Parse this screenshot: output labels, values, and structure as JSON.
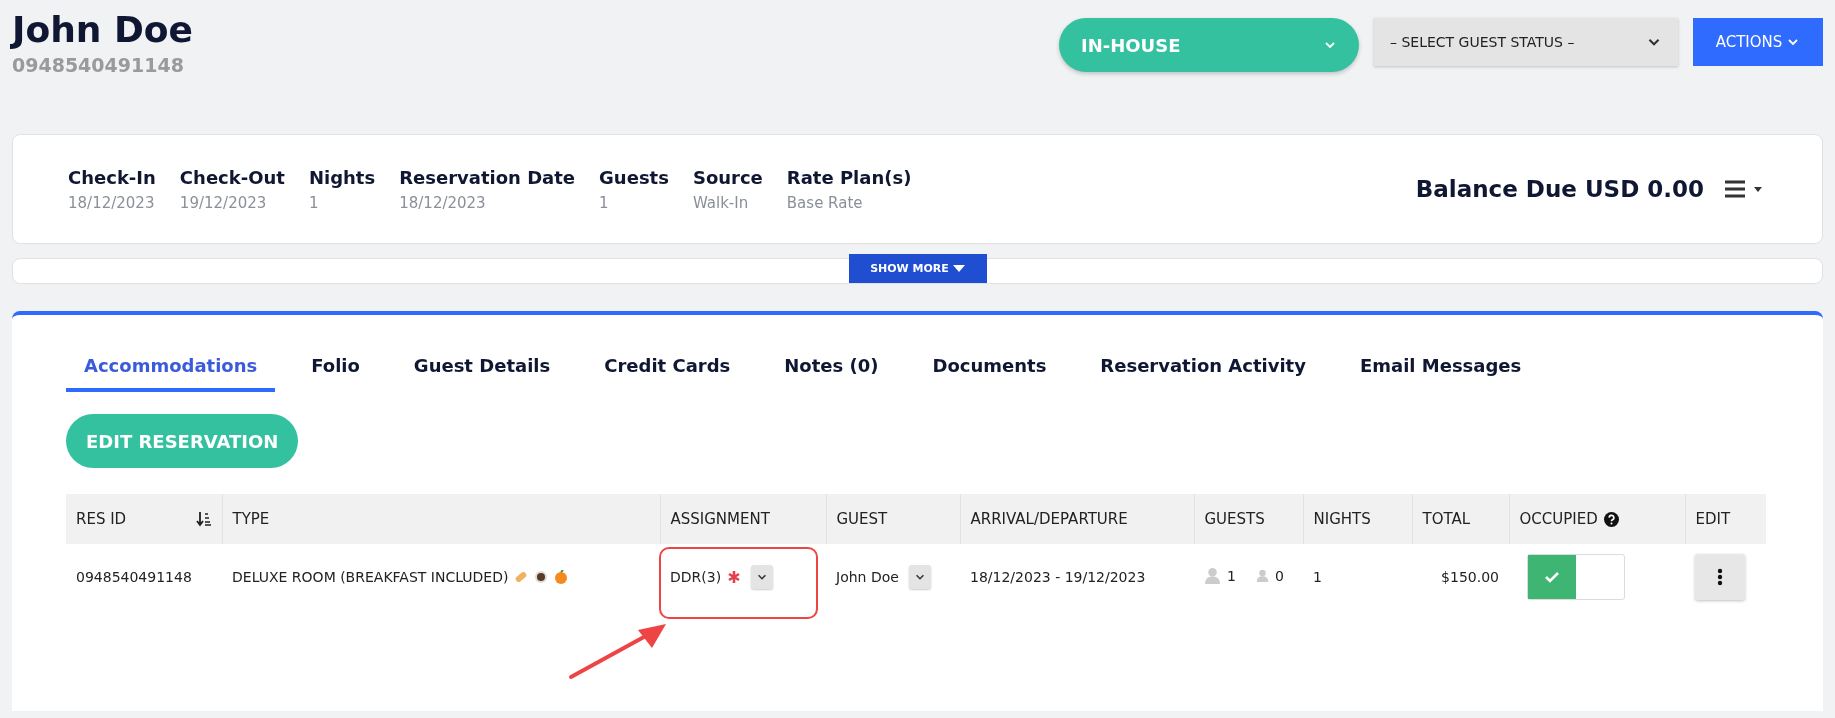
{
  "guest": {
    "name": "John Doe",
    "phone": "0948540491148"
  },
  "header_controls": {
    "status": "IN-HOUSE",
    "guest_status_placeholder": "– SELECT GUEST STATUS –",
    "actions": "ACTIONS"
  },
  "summary": {
    "fields": [
      {
        "label": "Check-In",
        "value": "18/12/2023"
      },
      {
        "label": "Check-Out",
        "value": "19/12/2023"
      },
      {
        "label": "Nights",
        "value": "1"
      },
      {
        "label": "Reservation Date",
        "value": "18/12/2023"
      },
      {
        "label": "Guests",
        "value": "1"
      },
      {
        "label": "Source",
        "value": "Walk-In"
      },
      {
        "label": "Rate Plan(s)",
        "value": "Base Rate"
      }
    ],
    "balance": "Balance Due USD 0.00"
  },
  "show_more": "SHOW MORE",
  "tabs": [
    {
      "label": "Accommodations",
      "selected": true
    },
    {
      "label": "Folio",
      "selected": false
    },
    {
      "label": "Guest Details",
      "selected": false
    },
    {
      "label": "Credit Cards",
      "selected": false
    },
    {
      "label": "Notes (0)",
      "selected": false
    },
    {
      "label": "Documents",
      "selected": false
    },
    {
      "label": "Reservation Activity",
      "selected": false
    },
    {
      "label": "Email Messages",
      "selected": false
    }
  ],
  "edit_reservation": "EDIT RESERVATION",
  "table": {
    "columns": [
      "RES ID",
      "TYPE",
      "ASSIGNMENT",
      "GUEST",
      "ARRIVAL/DEPARTURE",
      "GUESTS",
      "NIGHTS",
      "TOTAL",
      "OCCUPIED",
      "EDIT"
    ],
    "rows": [
      {
        "res_id": "0948540491148",
        "type": "DELUXE ROOM (BREAKFAST INCLUDED)",
        "assignment": "DDR(3)",
        "assignment_required": true,
        "assignment_highlighted": true,
        "guest": "John Doe",
        "dates": "18/12/2023 - 19/12/2023",
        "adults": "1",
        "children": "0",
        "nights": "1",
        "total": "$150.00",
        "occupied": true
      }
    ]
  }
}
